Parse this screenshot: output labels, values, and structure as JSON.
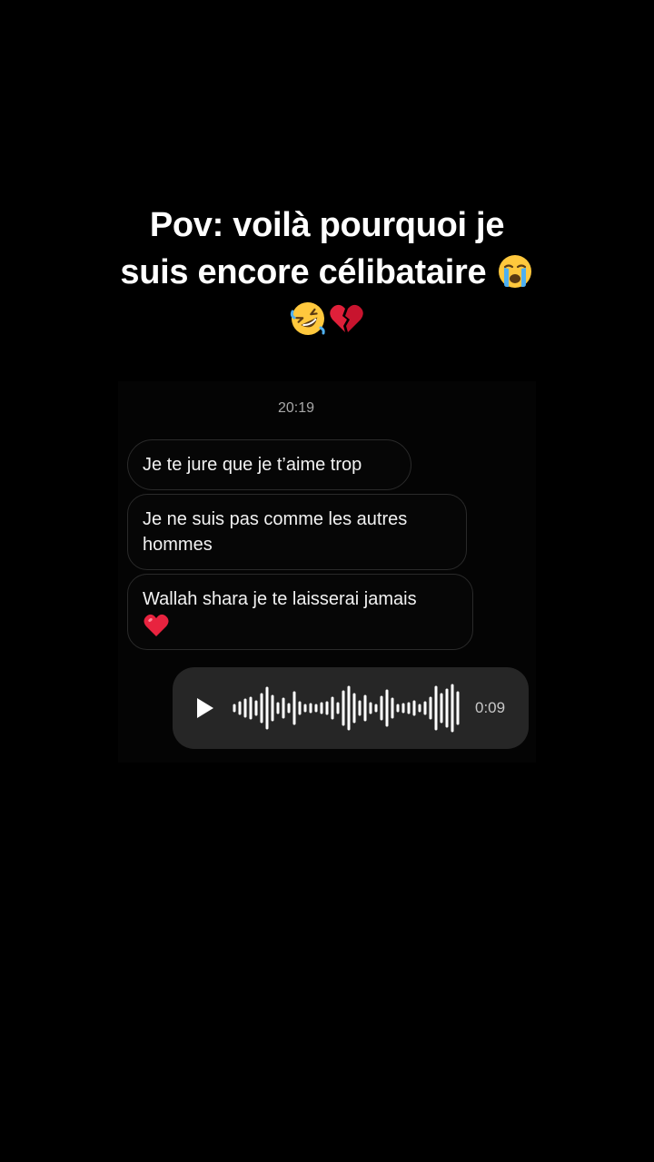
{
  "caption": {
    "line1": "Pov: voilà pourquoi je",
    "line2": "suis encore célibataire",
    "emojis": [
      "loudly-crying-face",
      "rolling-on-floor-laughing",
      "broken-heart"
    ]
  },
  "chat": {
    "timestamp": "20:19",
    "messages": [
      {
        "text": "Je te jure que je t’aime trop"
      },
      {
        "text": "Je ne suis pas comme les autres hommes"
      },
      {
        "text": "Wallah shara je te laisserai jamais",
        "emoji": "red-heart"
      }
    ],
    "voice_message": {
      "duration": "0:09",
      "icon": "play-icon"
    }
  },
  "colors": {
    "background": "#000000",
    "bubble_border": "#2a2a2a",
    "voice_bubble": "#262626",
    "timestamp": "#a8a8a8"
  }
}
